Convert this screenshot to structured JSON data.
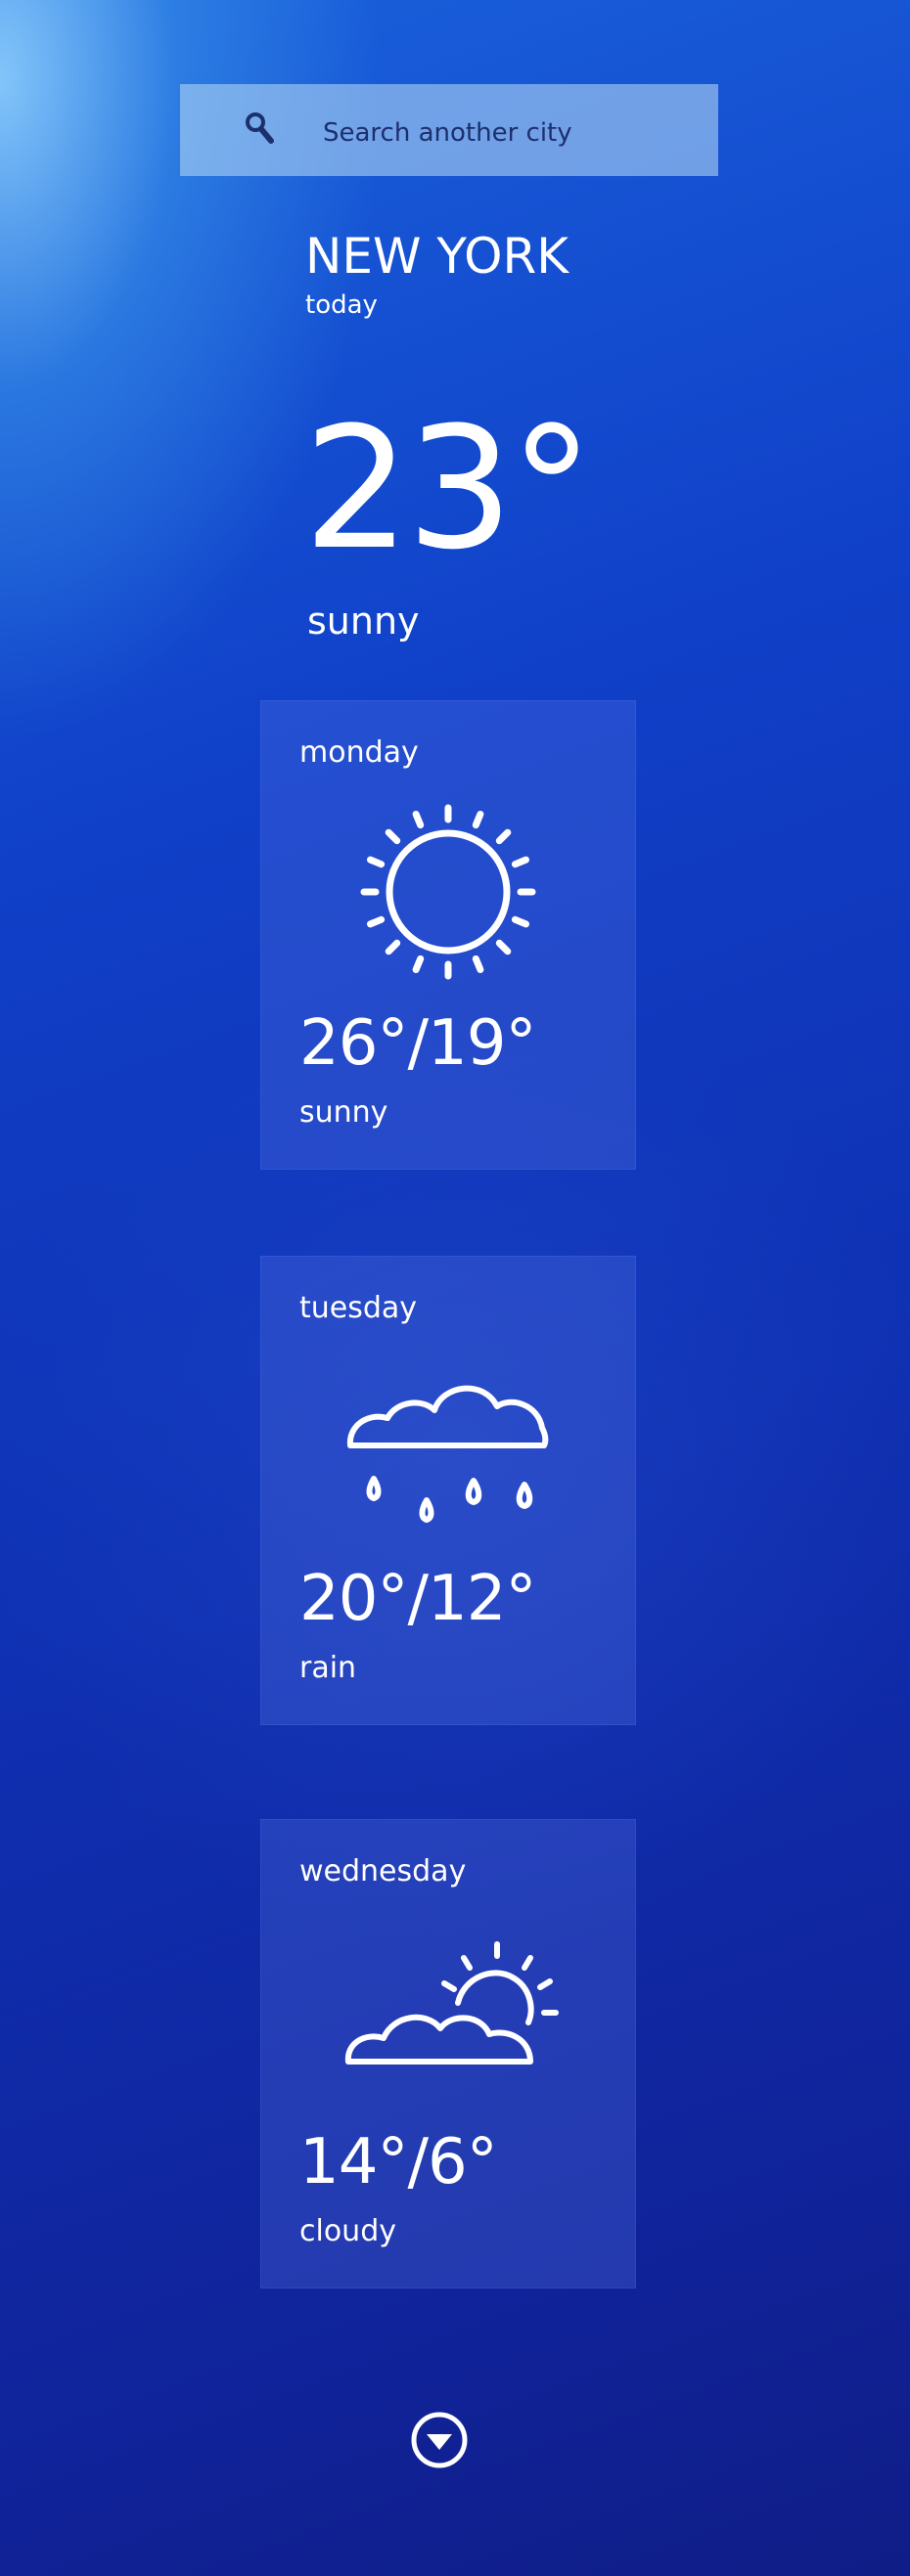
{
  "search": {
    "placeholder": "Search another city",
    "value": ""
  },
  "location": {
    "city": "NEW YORK",
    "day": "today"
  },
  "current": {
    "temperature": "23°",
    "condition": "sunny"
  },
  "forecast": [
    {
      "day": "monday",
      "temp": "26°/19°",
      "condition": "sunny",
      "icon": "sun-icon"
    },
    {
      "day": "tuesday",
      "temp": "20°/12°",
      "condition": "rain",
      "icon": "rain-cloud-icon"
    },
    {
      "day": "wednesday",
      "temp": "14°/6°",
      "condition": "cloudy",
      "icon": "partly-cloudy-icon"
    }
  ],
  "colors": {
    "search_text": "#1c2f6e",
    "search_bg": "#b4d7f5",
    "background_top": "#1a62dc",
    "background_bottom": "#0f1d86",
    "text": "#ffffff"
  },
  "icons": {
    "search": "search-icon",
    "scroll": "chevron-down-circle-icon"
  }
}
